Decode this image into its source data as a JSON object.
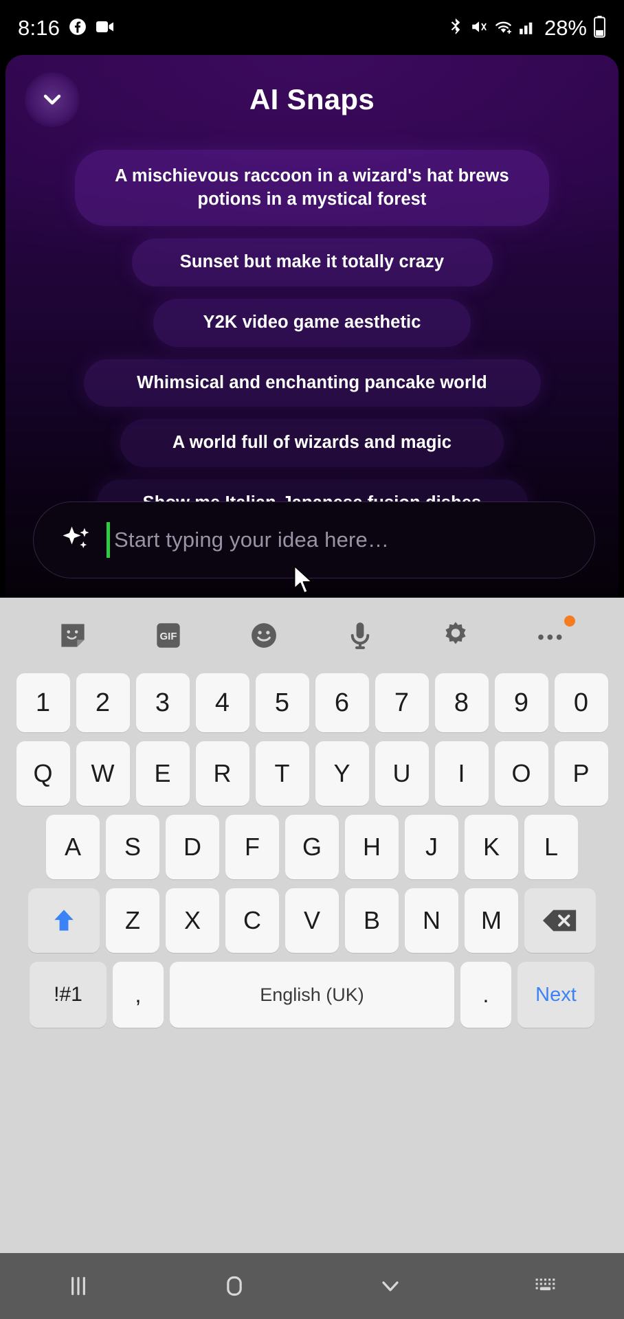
{
  "statusbar": {
    "time": "8:16",
    "battery_percent": "28%",
    "left_icons": [
      "facebook-icon",
      "video-camera-icon"
    ],
    "right_icons": [
      "bluetooth-icon",
      "mute-icon",
      "wifi-icon",
      "cellular-signal-icon"
    ]
  },
  "panel": {
    "title": "AI Snaps",
    "collapse_icon": "chevron-down-icon"
  },
  "suggestions": [
    "A mischievous raccoon in a wizard's hat brews potions in a mystical forest",
    "Sunset but make it totally crazy",
    "Y2K video game aesthetic",
    "Whimsical and enchanting pancake world",
    "A world full of wizards and magic",
    "Show me Italian-Japanese fusion dishes"
  ],
  "input": {
    "placeholder": "Start typing your idea here…",
    "value": "",
    "leading_icon": "sparkle-icon",
    "caret_color": "#2ecc40"
  },
  "keyboard": {
    "toolbar": [
      {
        "name": "sticker-icon",
        "label": ""
      },
      {
        "name": "gif-icon",
        "label": "GIF"
      },
      {
        "name": "emoji-icon",
        "label": ""
      },
      {
        "name": "microphone-icon",
        "label": ""
      },
      {
        "name": "settings-gear-icon",
        "label": ""
      },
      {
        "name": "more-options-icon",
        "label": ""
      }
    ],
    "number_row": [
      "1",
      "2",
      "3",
      "4",
      "5",
      "6",
      "7",
      "8",
      "9",
      "0"
    ],
    "row1": [
      "Q",
      "W",
      "E",
      "R",
      "T",
      "Y",
      "U",
      "I",
      "O",
      "P"
    ],
    "row2": [
      "A",
      "S",
      "D",
      "F",
      "G",
      "H",
      "J",
      "K",
      "L"
    ],
    "row3": [
      "Z",
      "X",
      "C",
      "V",
      "B",
      "N",
      "M"
    ],
    "shift_label": "shift-key",
    "backspace_label": "backspace-key",
    "symbols_label": "!#1",
    "comma_label": ",",
    "space_label": "English (UK)",
    "period_label": ".",
    "next_label": "Next",
    "accent_color": "#3b82f6",
    "background_color": "#d5d5d5"
  },
  "navbar": {
    "items": [
      "recents-icon",
      "home-icon",
      "collapse-keyboard-icon",
      "keyboard-switch-icon"
    ]
  }
}
